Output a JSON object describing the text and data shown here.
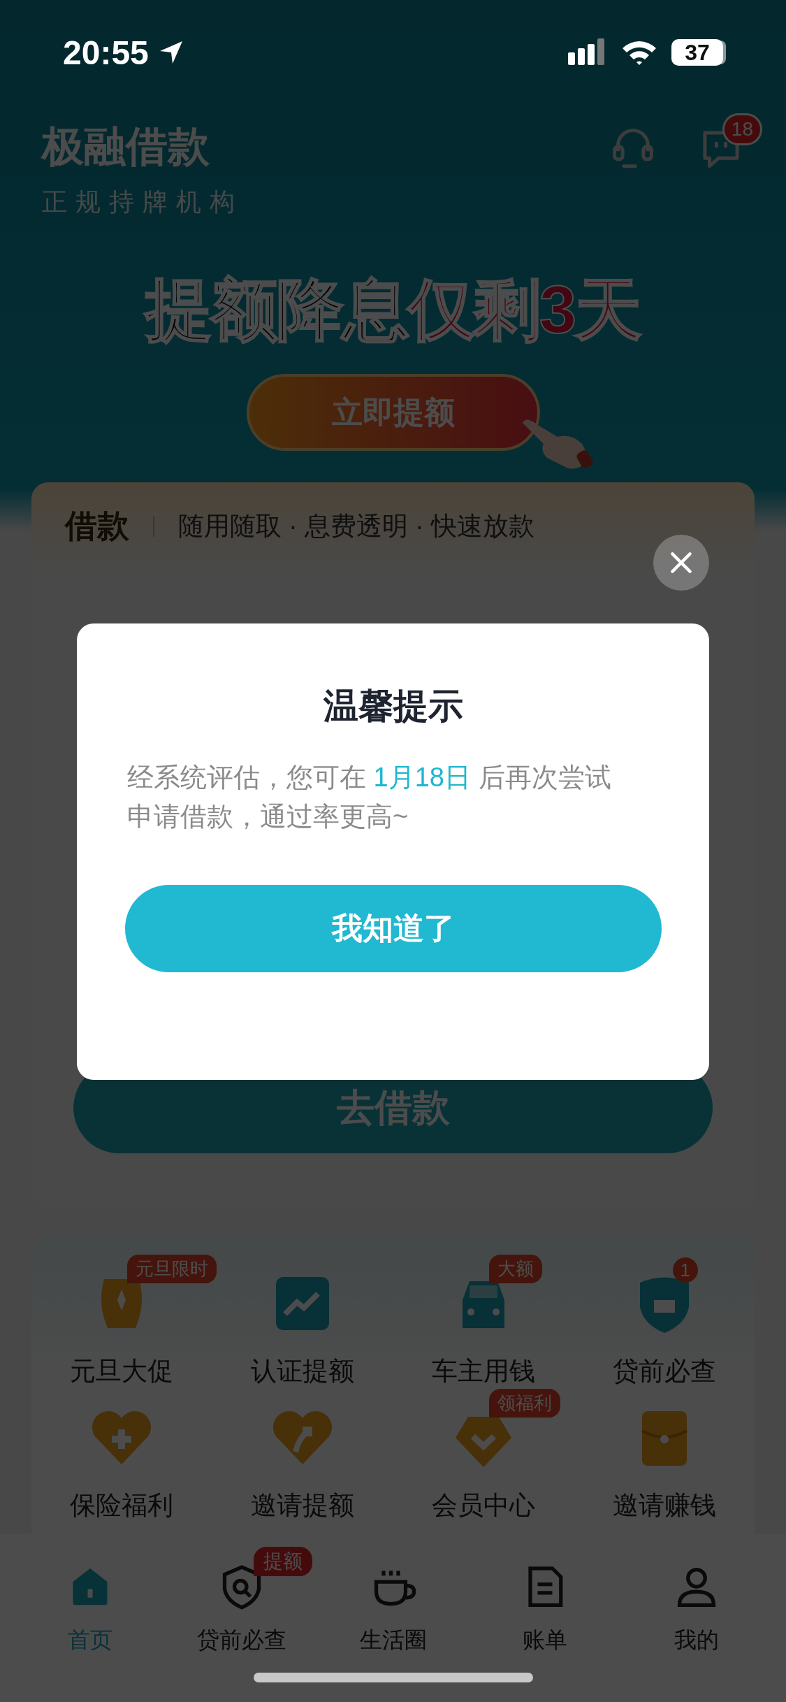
{
  "status_bar": {
    "time": "20:55",
    "battery": "37"
  },
  "header": {
    "title": "极融借款",
    "subtitle": "正规持牌机构",
    "message_badge": "18"
  },
  "banner": {
    "headline": "提额降息",
    "headline_highlight": "仅剩3天",
    "button": "立即提额"
  },
  "loan_card": {
    "title": "借款",
    "features": "随用随取 · 息费透明 · 快速放款",
    "button": "去借款"
  },
  "services": [
    {
      "label": "元旦大促",
      "badge": "元旦限时"
    },
    {
      "label": "认证提额"
    },
    {
      "label": "车主用钱",
      "badge": "大额"
    },
    {
      "label": "贷前必查",
      "count": "1"
    },
    {
      "label": "保险福利"
    },
    {
      "label": "邀请提额"
    },
    {
      "label": "会员中心",
      "badge": "领福利"
    },
    {
      "label": "邀请赚钱"
    }
  ],
  "nav": [
    {
      "label": "首页",
      "selected": true
    },
    {
      "label": "贷前必查",
      "selected": false,
      "badge": "提额"
    },
    {
      "label": "生活圈",
      "selected": false
    },
    {
      "label": "账单",
      "selected": false
    },
    {
      "label": "我的",
      "selected": false
    }
  ],
  "dialog": {
    "title": "温馨提示",
    "message_before": "经系统评估，您可在 ",
    "date": "1月18日",
    "message_after": " 后再次尝试申请借款，通过率更高~",
    "button": "我知道了"
  }
}
